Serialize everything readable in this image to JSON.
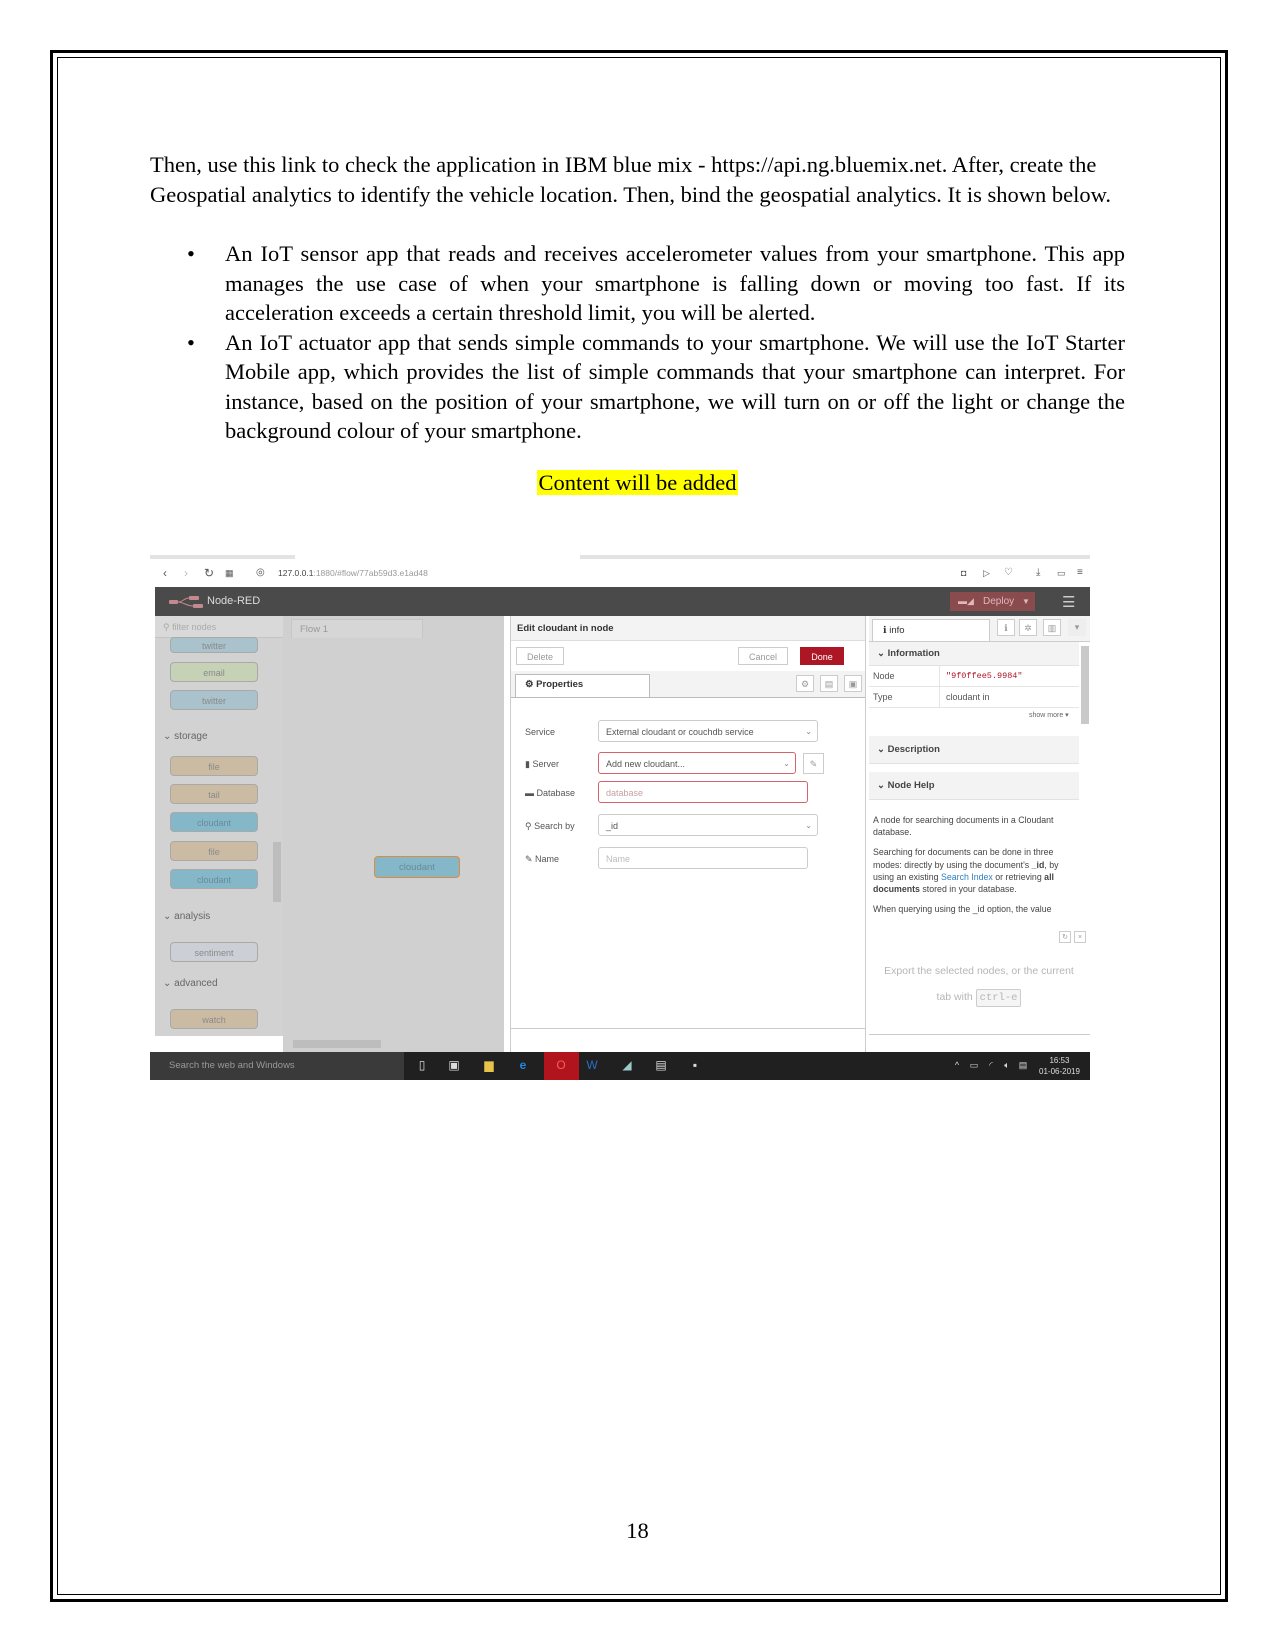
{
  "document": {
    "paragraph": "Then, use this link to check the application in IBM blue mix - https://api.ng.bluemix.net. After, create the Geospatial analytics to identify the vehicle location. Then, bind the geospatial analytics. It is shown below.",
    "bullets": [
      "An IoT sensor app that reads and receives accelerometer values from your smartphone. This app manages the use case of when your smartphone is falling down or moving too fast. If its acceleration exceeds a certain threshold limit, you will be alerted.",
      "An IoT actuator app that sends simple commands to your smartphone. We will use the IoT Starter Mobile app, which provides the list of simple commands that your smartphone can interpret. For instance, based on the position of your smartphone, we will turn on or off the light or change the background colour of your smartphone."
    ],
    "highlight": "Content will be added",
    "highlight_color": "#ffff00",
    "page_number": "18"
  },
  "screenshot": {
    "browser": {
      "url_host": "127.0.0.1",
      "url_rest": ":1880/#flow/77ab59d3.e1ad48"
    },
    "header": {
      "title": "Node-RED",
      "deploy_label": "Deploy",
      "deploy_color": "#8a4b4f"
    },
    "palette": {
      "filter_placeholder": "filter nodes",
      "nodes_top": [
        "twitter",
        "email",
        "twitter"
      ],
      "categories": [
        "storage",
        "analysis",
        "advanced"
      ],
      "storage_nodes": [
        "file",
        "tail",
        "cloudant",
        "file",
        "cloudant"
      ],
      "analysis_nodes": [
        "sentiment"
      ],
      "advanced_nodes": [
        "watch"
      ]
    },
    "canvas": {
      "tab": "Flow 1",
      "node": "cloudant"
    },
    "editor": {
      "title": "Edit cloudant in node",
      "delete_label": "Delete",
      "cancel_label": "Cancel",
      "done_label": "Done",
      "done_color": "#ad1625",
      "tab_properties": "Properties",
      "fields": {
        "service_label": "Service",
        "service_value": "External cloudant or couchdb service",
        "server_label": "Server",
        "server_value": "Add new cloudant...",
        "database_label": "Database",
        "database_placeholder": "database",
        "searchby_label": "Search by",
        "searchby_value": "_id",
        "name_label": "Name",
        "name_placeholder": "Name"
      }
    },
    "sidebar": {
      "tab": "info",
      "information": "Information",
      "node_key": "Node",
      "node_value": "\"9f0ffee5.9984\"",
      "type_key": "Type",
      "type_value": "cloudant in",
      "show_more": "show more",
      "description": "Description",
      "node_help": "Node Help",
      "help_p1": "A node for searching documents in a Cloudant database.",
      "help_p2a": "Searching for documents can be done in three modes: directly by using the document's ",
      "help_p2_id": "_id",
      "help_p2b": ", by using an existing ",
      "help_p2_link": "Search Index",
      "help_p2c": " or retrieving ",
      "help_p2_bold": "all documents",
      "help_p2d": " stored in your database.",
      "help_p3": "When querying using the _id option, the value",
      "export_text": "Export the selected nodes, or the current tab with",
      "export_kbd": "ctrl-e"
    },
    "taskbar": {
      "search": "Search the web and Windows",
      "time": "16:53",
      "date": "01-06-2019"
    }
  }
}
